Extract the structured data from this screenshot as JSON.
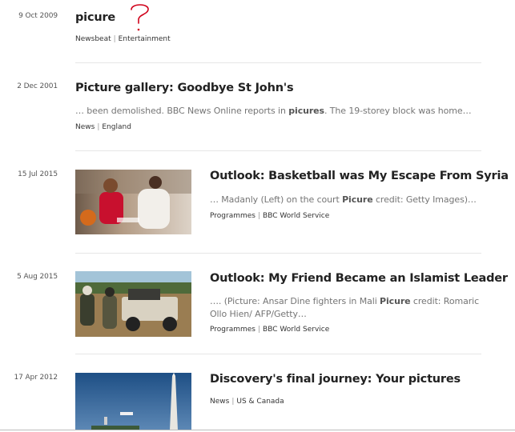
{
  "results": [
    {
      "date": "9 Oct 2009",
      "title": "picure",
      "snippet": [],
      "meta": [
        "Newsbeat",
        "Entertainment"
      ]
    },
    {
      "date": "2 Dec 2001",
      "title": "Picture gallery: Goodbye St John's",
      "snippet": [
        {
          "text": "… been demolished. BBC News Online reports in ",
          "bold": false
        },
        {
          "text": "picures",
          "bold": true
        },
        {
          "text": ". The 19-storey block was home…",
          "bold": false
        }
      ],
      "meta": [
        "News",
        "England"
      ]
    },
    {
      "date": "15 Jul 2015",
      "title": "Outlook: Basketball was My Escape From Syria",
      "snippet": [
        {
          "text": "… Madanly (Left) on the court ",
          "bold": false
        },
        {
          "text": "Picure",
          "bold": true
        },
        {
          "text": " credit: Getty Images)…",
          "bold": false
        }
      ],
      "meta": [
        "Programmes",
        "BBC World Service"
      ],
      "image": "basketball-players-photo"
    },
    {
      "date": "5 Aug 2015",
      "title": "Outlook: My Friend Became an Islamist Leader",
      "snippet": [
        {
          "text": "…. (Picture: Ansar Dine fighters in Mali ",
          "bold": false
        },
        {
          "text": "Picure",
          "bold": true
        },
        {
          "text": " credit: Romaric Ollo Hien/ AFP/Getty…",
          "bold": false
        }
      ],
      "meta": [
        "Programmes",
        "BBC World Service"
      ],
      "image": "fighters-truck-photo"
    },
    {
      "date": "17 Apr 2012",
      "title": "Discovery's final journey: Your pictures",
      "snippet": [],
      "meta": [
        "News",
        "US & Canada"
      ],
      "image": "shuttle-monument-photo"
    }
  ],
  "annotation": {
    "symbol": "?",
    "color": "#d0021b"
  }
}
